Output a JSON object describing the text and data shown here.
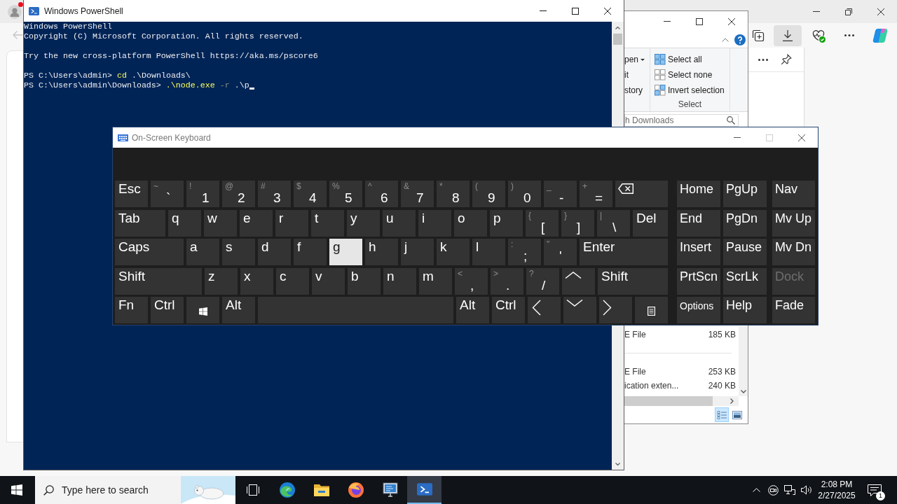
{
  "browser": {
    "profile_alert": true,
    "back_enabled": false,
    "downloads_active": true
  },
  "explorer": {
    "ribbon": {
      "open_items": [
        {
          "label": "pen",
          "dropdown": true
        },
        {
          "label": "it",
          "dropdown": false
        },
        {
          "label": "story",
          "dropdown": false
        }
      ],
      "select_group": {
        "label": "Select",
        "items": [
          {
            "kind": "all",
            "label": "Select all"
          },
          {
            "kind": "none",
            "label": "Select none"
          },
          {
            "kind": "invert",
            "label": "Invert selection"
          }
        ]
      }
    },
    "search": {
      "placeholder": "h Downloads"
    },
    "file_groups": [
      {
        "files": [
          {
            "type": "E File",
            "size": "185 KB"
          }
        ]
      },
      {
        "files": [
          {
            "type": "E File",
            "size": "253 KB"
          },
          {
            "type": "ication exten...",
            "size": "240 KB"
          }
        ]
      }
    ],
    "view_buttons": [
      {
        "kind": "details",
        "selected": true
      },
      {
        "kind": "large_icons",
        "selected": false
      }
    ]
  },
  "powershell": {
    "title": "Windows PowerShell",
    "blocks": [
      [
        [
          {
            "kind": "output",
            "text": "Windows PowerShell"
          }
        ],
        [
          {
            "kind": "output",
            "text": "Copyright (C) Microsoft Corporation. All rights reserved."
          }
        ]
      ],
      [
        [
          {
            "kind": "output",
            "text": "Try the new cross-platform PowerShell https://aka.ms/pscore6"
          }
        ]
      ],
      [
        [
          {
            "kind": "prompt",
            "text": "PS C:\\Users\\admin>"
          },
          {
            "kind": "command",
            "text": "cd"
          },
          {
            "kind": "argument",
            "text": ".\\Downloads\\"
          }
        ],
        [
          {
            "kind": "prompt",
            "text": "PS C:\\Users\\admin\\Downloads>"
          },
          {
            "kind": "command",
            "text": ".\\node.exe"
          },
          {
            "kind": "parameter",
            "text": "-r"
          },
          {
            "kind": "argument",
            "text": ".\\p"
          }
        ]
      ]
    ],
    "cursor": true
  },
  "osk": {
    "title": "On-Screen Keyboard",
    "maximize_enabled": false,
    "rows": [
      [
        {
          "kind": "label",
          "label": "Esc",
          "highlighted": false
        },
        {
          "kind": "char",
          "shift": "~",
          "main": "`",
          "highlighted": false
        },
        {
          "kind": "char",
          "shift": "!",
          "main": "1",
          "highlighted": false
        },
        {
          "kind": "char",
          "shift": "@",
          "main": "2",
          "highlighted": false
        },
        {
          "kind": "char",
          "shift": "#",
          "main": "3",
          "highlighted": false
        },
        {
          "kind": "char",
          "shift": "$",
          "main": "4",
          "highlighted": false
        },
        {
          "kind": "char",
          "shift": "%",
          "main": "5",
          "highlighted": false
        },
        {
          "kind": "char",
          "shift": "^",
          "main": "6",
          "highlighted": false
        },
        {
          "kind": "char",
          "shift": "&",
          "main": "7",
          "highlighted": false
        },
        {
          "kind": "char",
          "shift": "*",
          "main": "8",
          "highlighted": false
        },
        {
          "kind": "char",
          "shift": "(",
          "main": "9",
          "highlighted": false
        },
        {
          "kind": "char",
          "shift": ")",
          "main": "0",
          "highlighted": false
        },
        {
          "kind": "char",
          "shift": "_",
          "main": "-",
          "highlighted": false
        },
        {
          "kind": "char",
          "shift": "+",
          "main": "=",
          "highlighted": false
        },
        {
          "kind": "backspace",
          "highlighted": false
        }
      ],
      [
        {
          "kind": "label",
          "label": "Tab",
          "highlighted": false
        },
        {
          "kind": "label",
          "label": "q",
          "highlighted": false
        },
        {
          "kind": "label",
          "label": "w",
          "highlighted": false
        },
        {
          "kind": "label",
          "label": "e",
          "highlighted": false
        },
        {
          "kind": "label",
          "label": "r",
          "highlighted": false
        },
        {
          "kind": "label",
          "label": "t",
          "highlighted": false
        },
        {
          "kind": "label",
          "label": "y",
          "highlighted": false
        },
        {
          "kind": "label",
          "label": "u",
          "highlighted": false
        },
        {
          "kind": "label",
          "label": "i",
          "highlighted": false
        },
        {
          "kind": "label",
          "label": "o",
          "highlighted": false
        },
        {
          "kind": "label",
          "label": "p",
          "highlighted": false
        },
        {
          "kind": "char",
          "shift": "{",
          "main": "[",
          "highlighted": false
        },
        {
          "kind": "char",
          "shift": "}",
          "main": "]",
          "highlighted": false
        },
        {
          "kind": "char",
          "shift": "|",
          "main": "\\",
          "highlighted": false
        },
        {
          "kind": "label",
          "label": "Del",
          "highlighted": false
        }
      ],
      [
        {
          "kind": "label",
          "label": "Caps",
          "highlighted": false
        },
        {
          "kind": "label",
          "label": "a",
          "highlighted": false
        },
        {
          "kind": "label",
          "label": "s",
          "highlighted": false
        },
        {
          "kind": "label",
          "label": "d",
          "highlighted": false
        },
        {
          "kind": "label",
          "label": "f",
          "highlighted": false
        },
        {
          "kind": "label",
          "label": "g",
          "highlighted": true
        },
        {
          "kind": "label",
          "label": "h",
          "highlighted": false
        },
        {
          "kind": "label",
          "label": "j",
          "highlighted": false
        },
        {
          "kind": "label",
          "label": "k",
          "highlighted": false
        },
        {
          "kind": "label",
          "label": "l",
          "highlighted": false
        },
        {
          "kind": "char",
          "shift": ":",
          "main": ";",
          "highlighted": false
        },
        {
          "kind": "char",
          "shift": "\"",
          "main": "'",
          "highlighted": false
        },
        {
          "kind": "label",
          "label": "Enter",
          "highlighted": false
        }
      ],
      [
        {
          "kind": "label",
          "label": "Shift",
          "highlighted": false
        },
        {
          "kind": "label",
          "label": "z",
          "highlighted": false
        },
        {
          "kind": "label",
          "label": "x",
          "highlighted": false
        },
        {
          "kind": "label",
          "label": "c",
          "highlighted": false
        },
        {
          "kind": "label",
          "label": "v",
          "highlighted": false
        },
        {
          "kind": "label",
          "label": "b",
          "highlighted": false
        },
        {
          "kind": "label",
          "label": "n",
          "highlighted": false
        },
        {
          "kind": "label",
          "label": "m",
          "highlighted": false
        },
        {
          "kind": "char",
          "shift": "<",
          "main": ",",
          "highlighted": false
        },
        {
          "kind": "char",
          "shift": ">",
          "main": ".",
          "highlighted": false
        },
        {
          "kind": "char",
          "shift": "?",
          "main": "/",
          "highlighted": false
        },
        {
          "kind": "up",
          "highlighted": false
        },
        {
          "kind": "label",
          "label": "Shift",
          "highlighted": false
        }
      ],
      [
        {
          "kind": "label",
          "label": "Fn",
          "highlighted": false
        },
        {
          "kind": "label",
          "label": "Ctrl",
          "highlighted": false
        },
        {
          "kind": "windows",
          "highlighted": false
        },
        {
          "kind": "label",
          "label": "Alt",
          "highlighted": false
        },
        {
          "kind": "space",
          "highlighted": false
        },
        {
          "kind": "label",
          "label": "Alt",
          "highlighted": false
        },
        {
          "kind": "label",
          "label": "Ctrl",
          "highlighted": false
        },
        {
          "kind": "left",
          "highlighted": false
        },
        {
          "kind": "down",
          "highlighted": false
        },
        {
          "kind": "right",
          "highlighted": false
        },
        {
          "kind": "menu",
          "highlighted": false
        }
      ]
    ],
    "side_rows": [
      [
        {
          "label": "Home",
          "disabled": false
        },
        {
          "label": "PgUp",
          "disabled": false
        },
        {
          "label": "Nav",
          "disabled": false
        }
      ],
      [
        {
          "label": "End",
          "disabled": false
        },
        {
          "label": "PgDn",
          "disabled": false
        },
        {
          "label": "Mv Up",
          "disabled": false
        }
      ],
      [
        {
          "label": "Insert",
          "disabled": false
        },
        {
          "label": "Pause",
          "disabled": false
        },
        {
          "label": "Mv Dn",
          "disabled": false
        }
      ],
      [
        {
          "label": "PrtScn",
          "disabled": false
        },
        {
          "label": "ScrLk",
          "disabled": false
        },
        {
          "label": "Dock",
          "disabled": true
        }
      ],
      [
        {
          "label": "Options",
          "disabled": false
        },
        {
          "label": "Help",
          "disabled": false
        },
        {
          "label": "Fade",
          "disabled": false
        }
      ]
    ]
  },
  "taskbar": {
    "search": {
      "placeholder": "Type here to search"
    },
    "apps": [
      {
        "kind": "edge",
        "active": false
      },
      {
        "kind": "explorer",
        "active": false
      },
      {
        "kind": "firefox",
        "active": false
      },
      {
        "kind": "monitor",
        "active": false
      },
      {
        "kind": "powershell",
        "active": true
      }
    ],
    "clock": {
      "time": "2:08 PM",
      "date": "2/27/2025"
    },
    "notifications": {
      "count": "1"
    }
  }
}
